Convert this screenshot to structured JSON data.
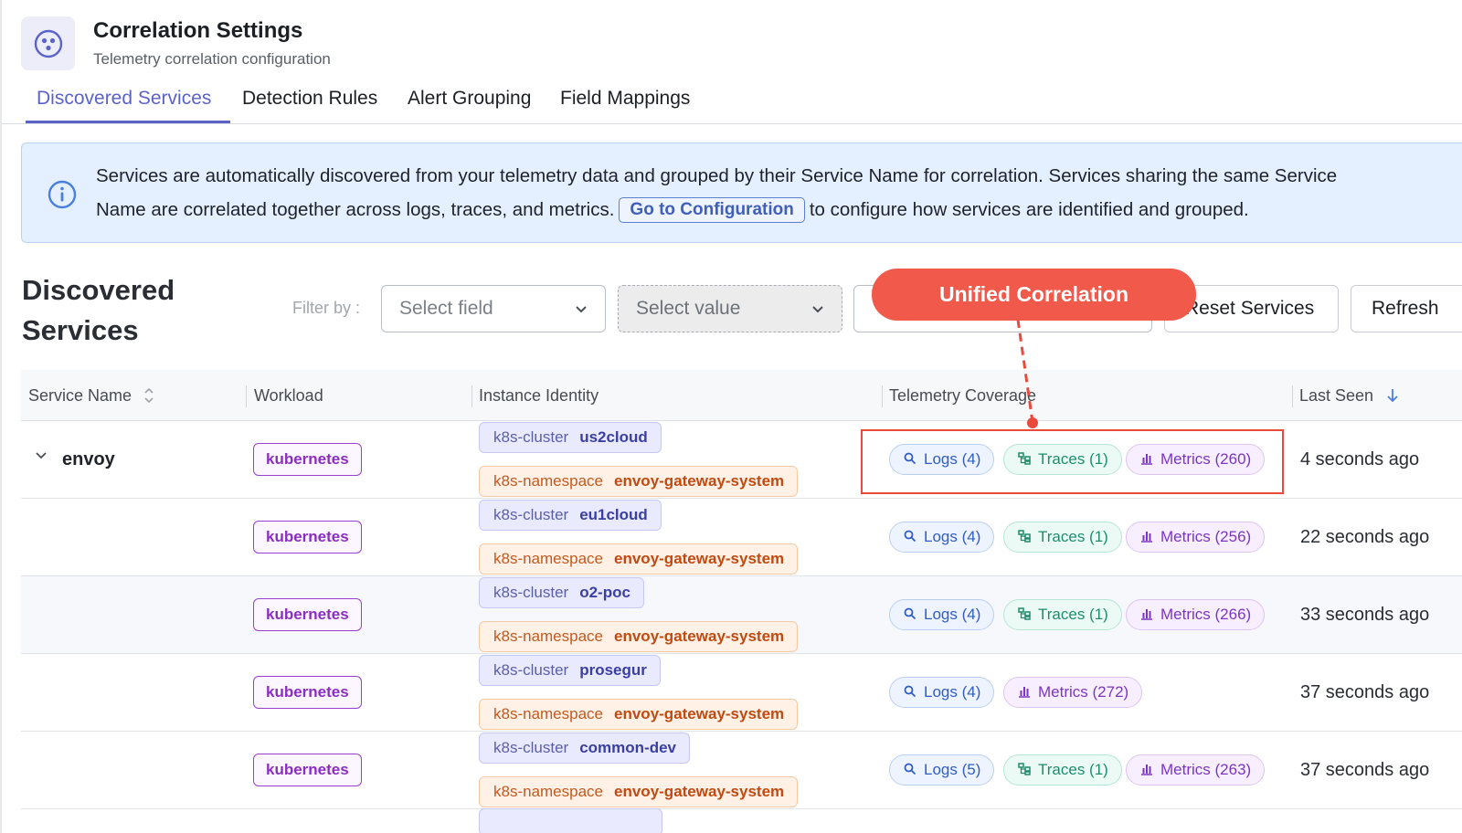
{
  "header": {
    "title": "Correlation Settings",
    "subtitle": "Telemetry correlation configuration",
    "icon": "correlation-icon"
  },
  "tabs": [
    {
      "label": "Discovered Services",
      "active": true
    },
    {
      "label": "Detection Rules",
      "active": false
    },
    {
      "label": "Alert Grouping",
      "active": false
    },
    {
      "label": "Field Mappings",
      "active": false
    }
  ],
  "banner": {
    "line1": "Services are automatically discovered from your telemetry data and grouped by their Service Name for correlation. Services sharing the same Service",
    "line2_before": "Name are correlated together across logs, traces, and metrics.",
    "config_button": "Go to Configuration",
    "line2_after": "to configure how services are identified and grouped."
  },
  "section": {
    "title": "Discovered Services",
    "filter_label": "Filter by :",
    "select_field_placeholder": "Select field",
    "select_value_placeholder": "Select value",
    "reset_button": "Reset Services",
    "refresh_button": "Refresh"
  },
  "callout": {
    "label": "Unified Correlation"
  },
  "table": {
    "columns": [
      "Service Name",
      "Workload",
      "Instance Identity",
      "Telemetry Coverage",
      "Last Seen"
    ],
    "rows": [
      {
        "service": "envoy",
        "workload": "kubernetes",
        "cluster_key": "k8s-cluster",
        "cluster": "us2cloud",
        "ns_key": "k8s-namespace",
        "namespace": "envoy-gateway-system",
        "logs": "Logs (4)",
        "traces": "Traces (1)",
        "metrics": "Metrics (260)",
        "last_seen": "4 seconds ago"
      },
      {
        "service": "",
        "workload": "kubernetes",
        "cluster_key": "k8s-cluster",
        "cluster": "eu1cloud",
        "ns_key": "k8s-namespace",
        "namespace": "envoy-gateway-system",
        "logs": "Logs (4)",
        "traces": "Traces (1)",
        "metrics": "Metrics (256)",
        "last_seen": "22 seconds ago"
      },
      {
        "service": "",
        "workload": "kubernetes",
        "cluster_key": "k8s-cluster",
        "cluster": "o2-poc",
        "ns_key": "k8s-namespace",
        "namespace": "envoy-gateway-system",
        "logs": "Logs (4)",
        "traces": "Traces (1)",
        "metrics": "Metrics (266)",
        "last_seen": "33 seconds ago"
      },
      {
        "service": "",
        "workload": "kubernetes",
        "cluster_key": "k8s-cluster",
        "cluster": "prosegur",
        "ns_key": "k8s-namespace",
        "namespace": "envoy-gateway-system",
        "logs": "Logs (4)",
        "traces": "",
        "metrics": "Metrics (272)",
        "last_seen": "37 seconds ago"
      },
      {
        "service": "",
        "workload": "kubernetes",
        "cluster_key": "k8s-cluster",
        "cluster": "common-dev",
        "ns_key": "k8s-namespace",
        "namespace": "envoy-gateway-system",
        "logs": "Logs (5)",
        "traces": "Traces (1)",
        "metrics": "Metrics (263)",
        "last_seen": "37 seconds ago"
      }
    ]
  },
  "colors": {
    "accent": "#5b63c9",
    "callout": "#f15a4a",
    "workload": "#8b2ec0",
    "logs": "#2f5dc4",
    "traces": "#1d8d6a",
    "metrics": "#7c35c2"
  }
}
